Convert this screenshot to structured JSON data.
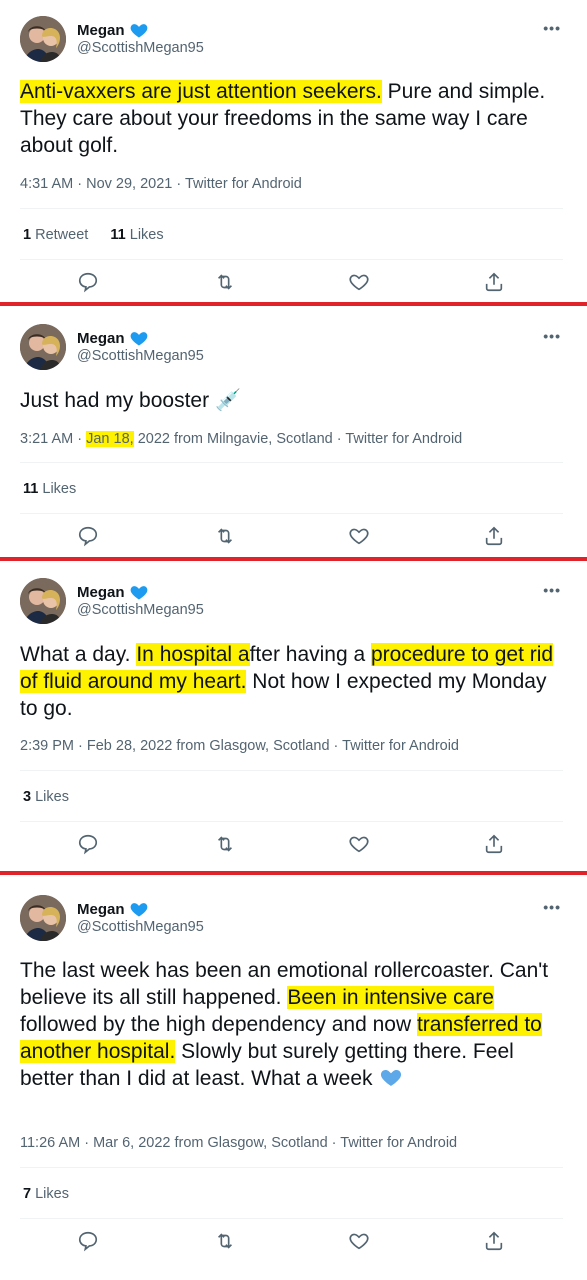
{
  "tweets": [
    {
      "name": "Megan",
      "handle": "@ScottishMegan95",
      "text_hl_1": "Anti-vaxxers are just attention seekers.",
      "text_1": " Pure and simple. They care about your freedoms in the same way I care about golf.",
      "time": "4:31 AM",
      "date": "Nov 29, 2021",
      "source": "Twitter for Android",
      "retweets": "1",
      "retweets_label": "Retweet",
      "likes": "11",
      "likes_label": "Likes"
    },
    {
      "name": "Megan",
      "handle": "@ScottishMegan95",
      "text": "Just had my booster",
      "emoji": "💉",
      "time": "3:21 AM",
      "date": "Jan 18,",
      "date_rest": " 2022 from Milngavie, Scotland",
      "source": "Twitter for Android",
      "likes": "11",
      "likes_label": "Likes"
    },
    {
      "name": "Megan",
      "handle": "@ScottishMegan95",
      "text_1": "What a day. ",
      "text_hl_1": "In hospital a",
      "text_2": "fter having a ",
      "text_hl_2": "procedure to get rid of fluid around my heart.",
      "text_3": " Not how I expected my Monday to go.",
      "time": "2:39 PM",
      "date": "Feb 28, 2022 from Glasgow, Scotland",
      "source": "Twitter for Android",
      "likes": "3",
      "likes_label": "Likes"
    },
    {
      "name": "Megan",
      "handle": "@ScottishMegan95",
      "text_1": "The last week has been an emotional rollercoaster. Can't believe its all still happened. ",
      "text_hl_1": "Been in intensive care",
      "text_2": " followed by the high dependency and now ",
      "text_hl_2": "transferred to another hospital.",
      "text_3": " Slowly but surely getting there. Feel better than I did at least. What a week",
      "time": "11:26 AM",
      "date": "Mar 6, 2022 from Glasgow, Scotland",
      "source": "Twitter for Android",
      "likes": "7",
      "likes_label": "Likes"
    }
  ],
  "more_label": "•••",
  "meta_sep": " · ",
  "icons": [
    "reply-icon",
    "retweet-icon",
    "like-icon",
    "share-icon",
    "verified-icon",
    "blue-heart-icon"
  ],
  "colors": {
    "highlight": "#fff200",
    "separator": "#e0232b",
    "verified": "#1d9bf0",
    "muted": "#536471"
  }
}
